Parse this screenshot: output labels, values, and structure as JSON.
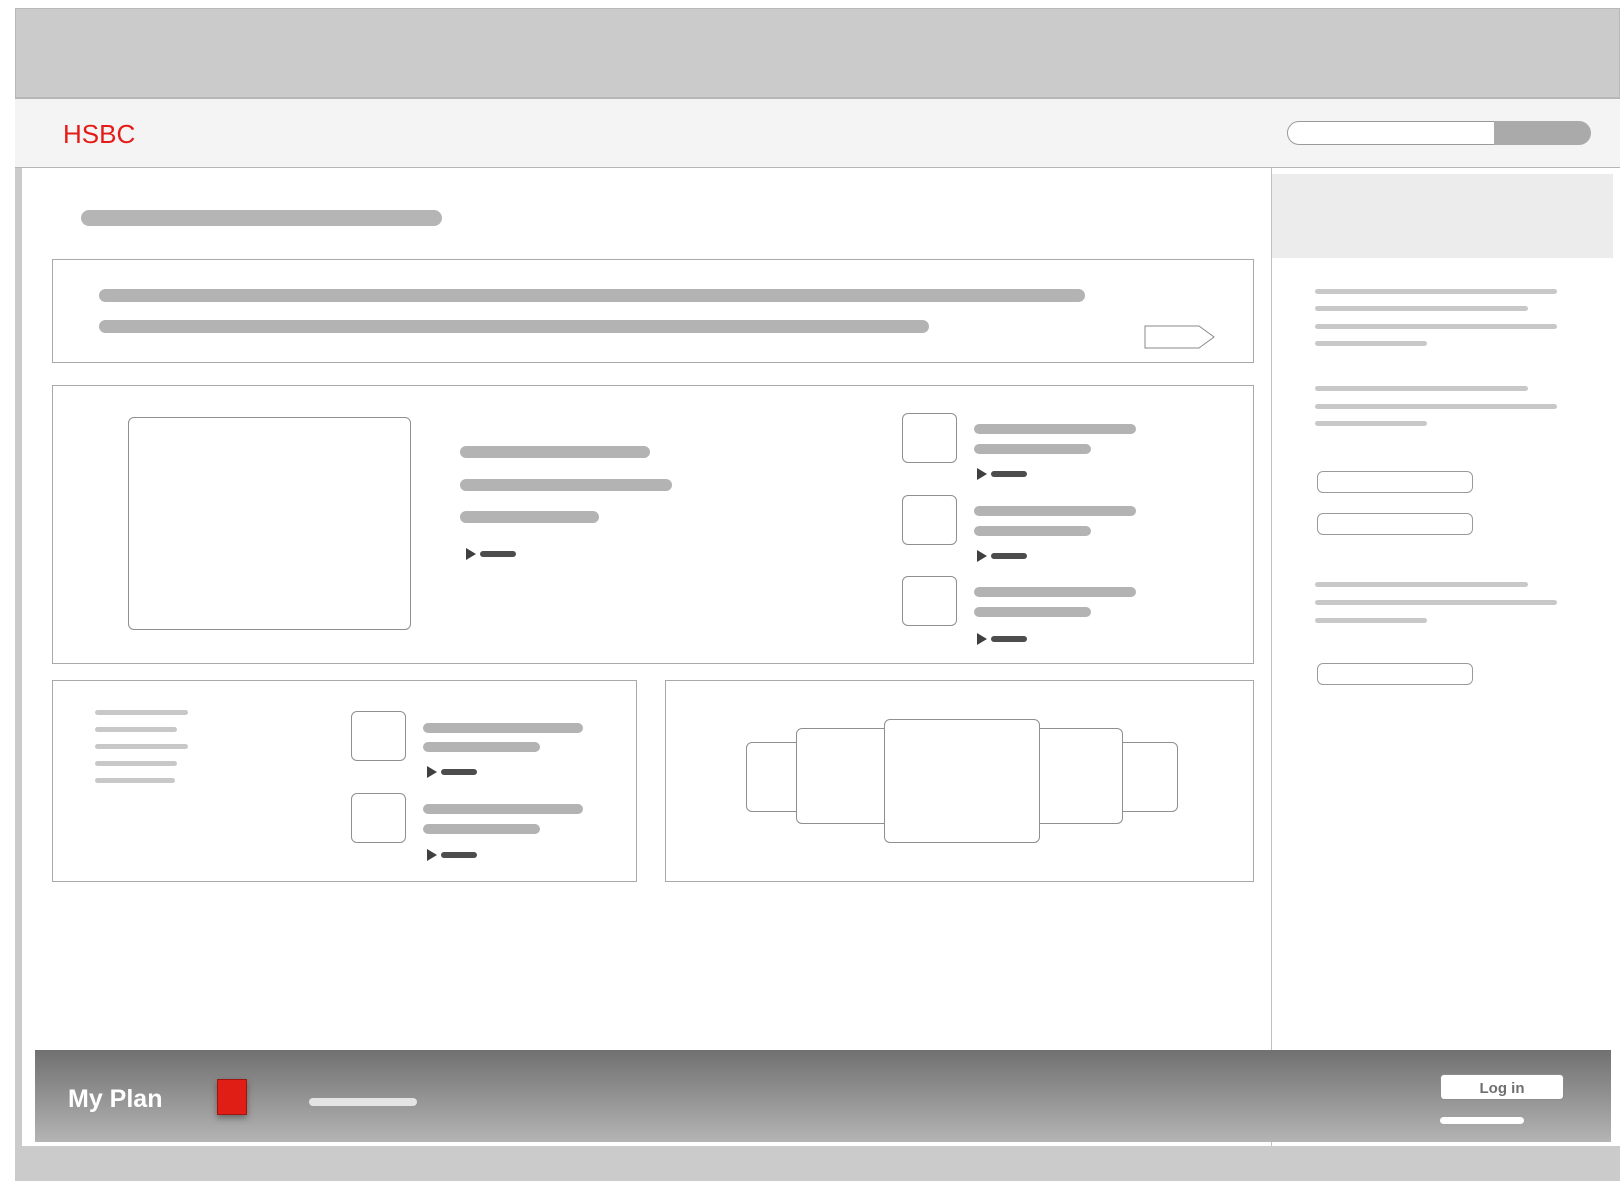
{
  "header": {
    "brand": "HSBC",
    "brand_color": "#e41b17"
  },
  "footer": {
    "title": "My Plan",
    "login_label": "Log in",
    "accent_color": "#e01e16"
  },
  "icons": [
    "play-arrow-icon",
    "tag-arrow-icon"
  ]
}
